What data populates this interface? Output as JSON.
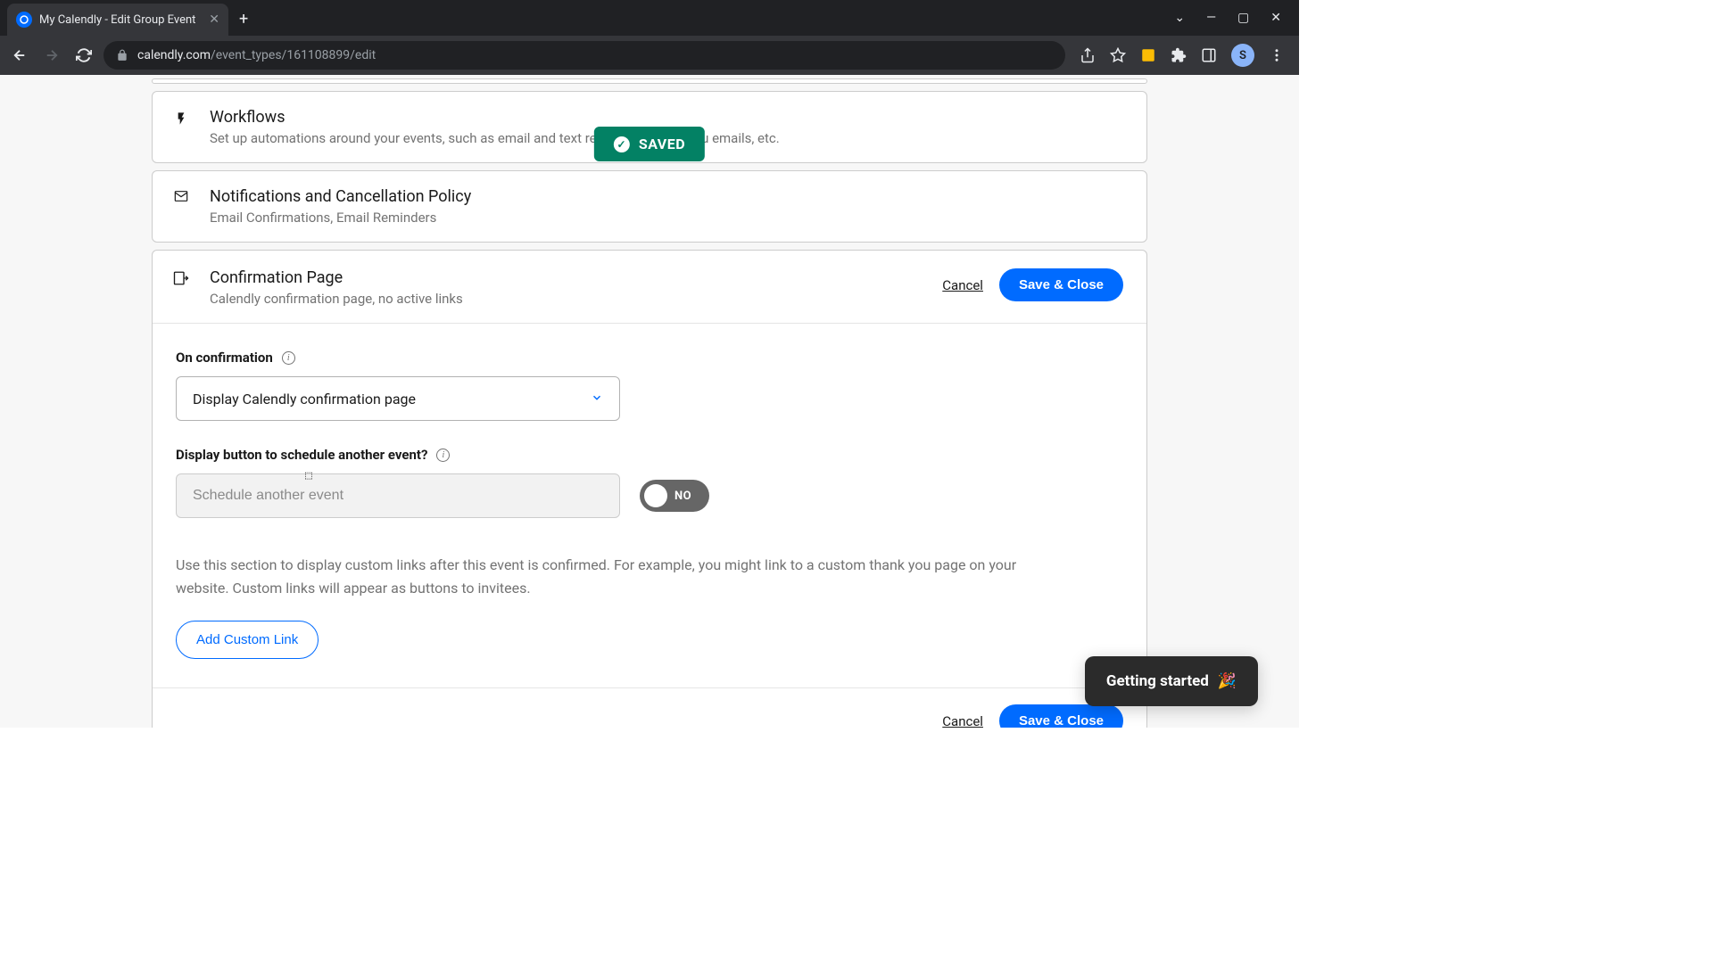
{
  "browser": {
    "tab_title": "My Calendly - Edit Group Event",
    "url_host": "calendly.com",
    "url_path": "/event_types/161108899/edit",
    "avatar_initial": "S"
  },
  "toast": {
    "label": "SAVED"
  },
  "sections": {
    "workflows": {
      "title": "Workflows",
      "subtitle": "Set up automations around your events, such as email and text reminders, thank you emails, etc."
    },
    "notifications": {
      "title": "Notifications and Cancellation Policy",
      "subtitle": "Email Confirmations, Email Reminders"
    },
    "confirmation": {
      "title": "Confirmation Page",
      "subtitle": "Calendly confirmation page, no active links",
      "cancel": "Cancel",
      "save_close": "Save & Close",
      "on_confirmation_label": "On confirmation",
      "on_confirmation_value": "Display Calendly confirmation page",
      "schedule_another_label": "Display button to schedule another event?",
      "schedule_another_value": "Schedule another event",
      "toggle_state": "NO",
      "help_text": "Use this section to display custom links after this event is confirmed. For example, you might link to a custom thank you page on your website. Custom links will appear as buttons to invitees.",
      "add_custom_link": "Add Custom Link"
    }
  },
  "help_widget": "Getting started"
}
